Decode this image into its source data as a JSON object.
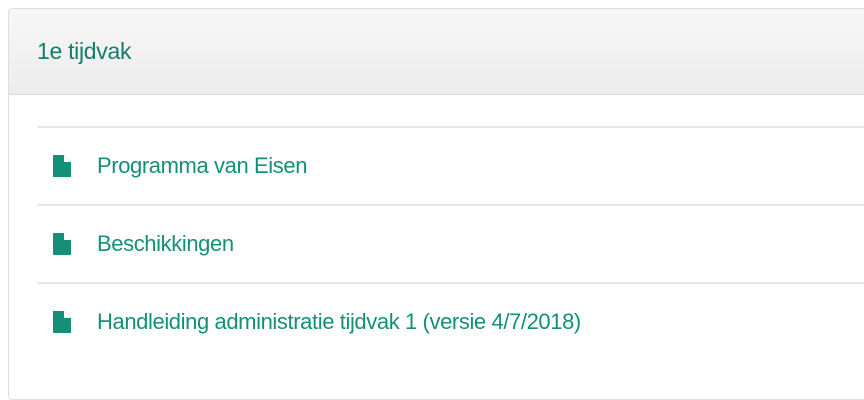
{
  "panel": {
    "title": "1e tijdvak",
    "accent_color": "#139077"
  },
  "documents": [
    {
      "label": "Programma van Eisen",
      "icon": "file-icon"
    },
    {
      "label": "Beschikkingen",
      "icon": "file-icon"
    },
    {
      "label": "Handleiding administratie tijdvak 1 (versie 4/7/2018)",
      "icon": "file-icon"
    }
  ]
}
